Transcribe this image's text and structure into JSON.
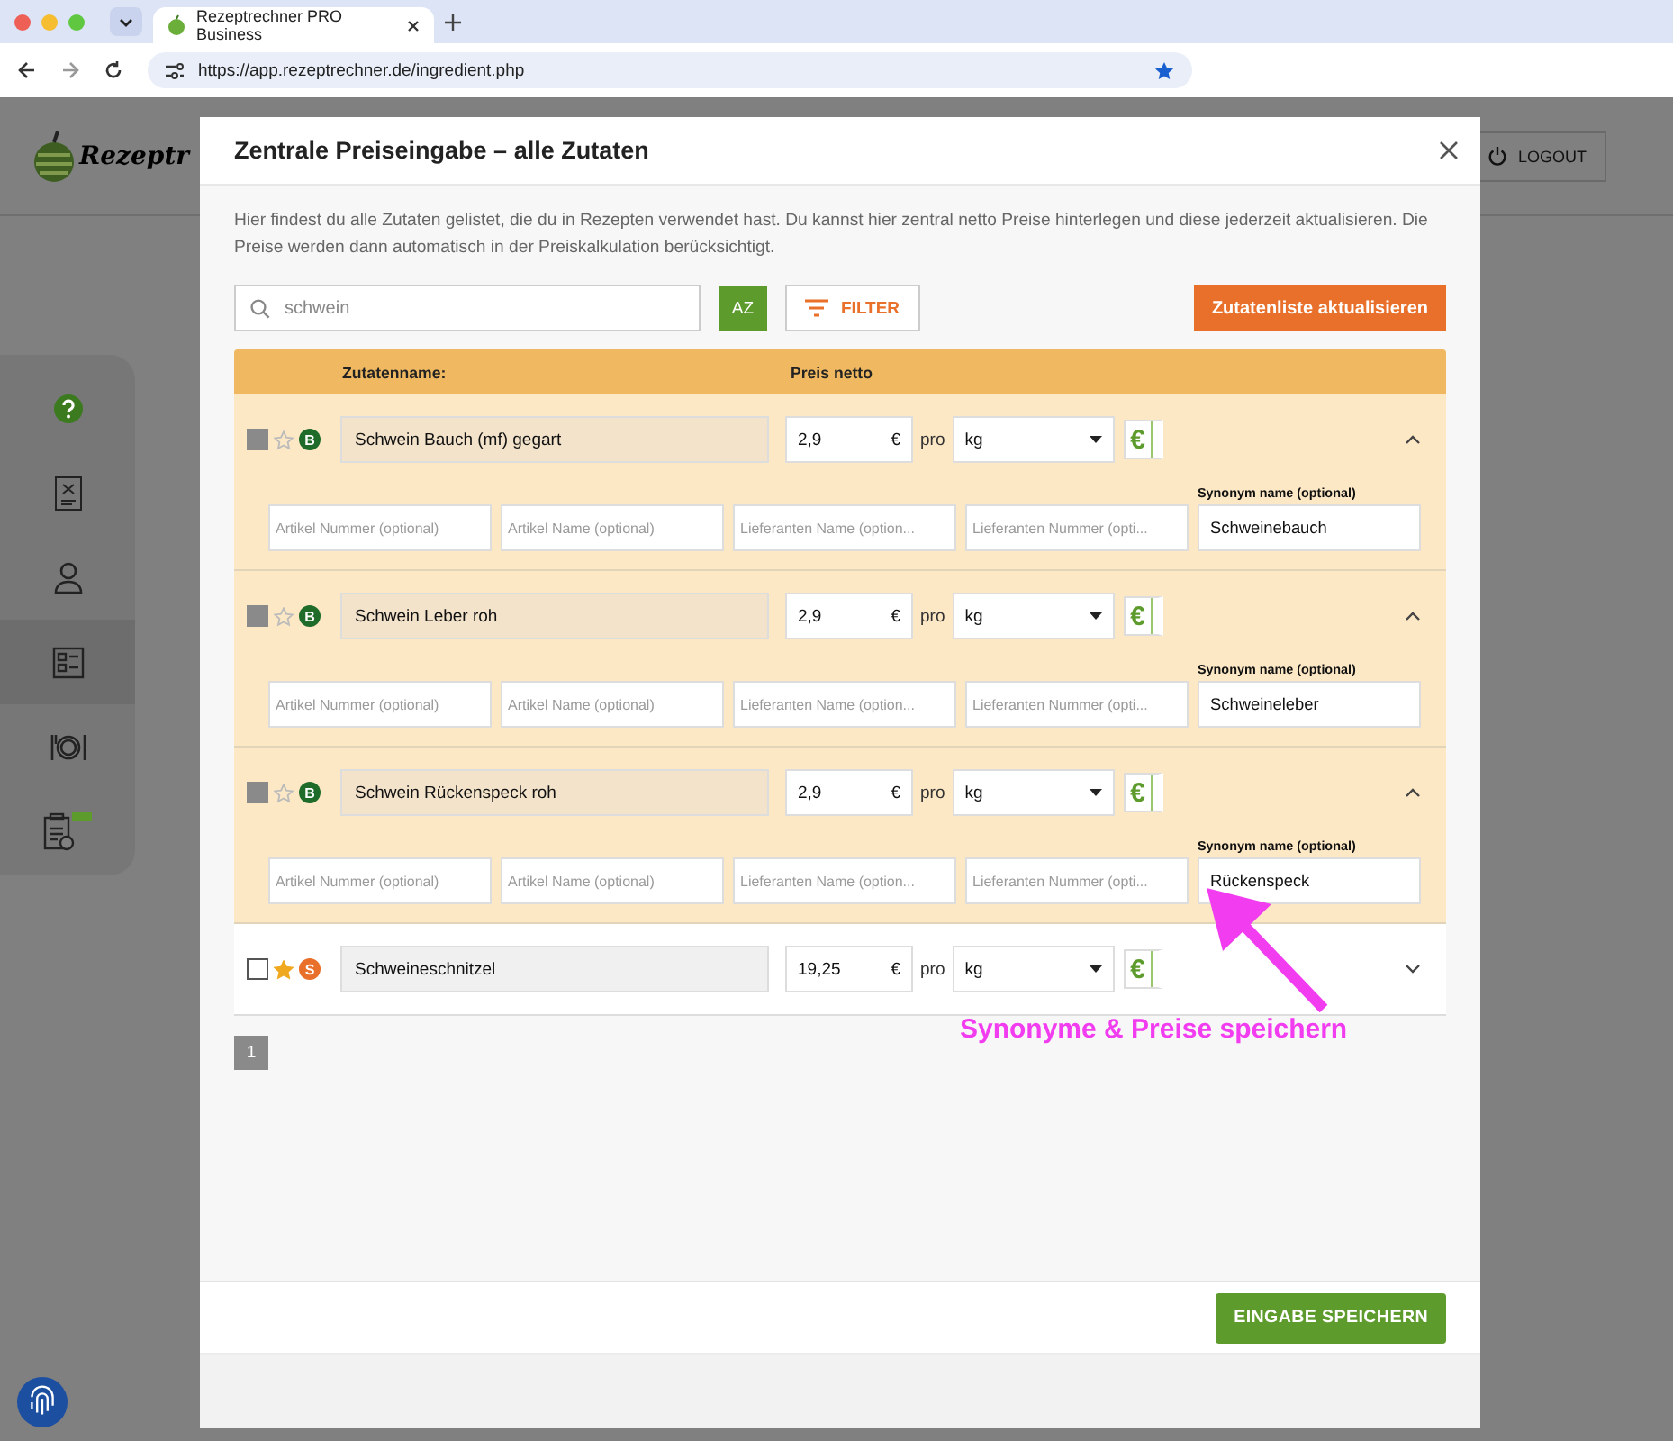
{
  "browser": {
    "tab_title": "Rezeptrechner PRO Business",
    "url": "https://app.rezeptrechner.de/ingredient.php"
  },
  "background": {
    "logo_text": "Rezeptr",
    "logout": "LOGOUT",
    "sidebar": [
      {
        "kind": "help",
        "selected": false
      },
      {
        "kind": "recipe",
        "selected": false
      },
      {
        "kind": "user",
        "selected": false
      },
      {
        "kind": "checklist",
        "selected": true
      },
      {
        "kind": "dish",
        "selected": false
      },
      {
        "kind": "clipboard",
        "selected": false
      }
    ]
  },
  "modal": {
    "title": "Zentrale Preiseingabe – alle Zutaten",
    "description": "Hier findest du alle Zutaten gelistet, die du in Rezepten verwendet hast. Du kannst hier zentral netto Preise hinterlegen und diese jederzeit aktualisieren. Die Preise werden dann automatisch in der Preiskalkulation berücksichtigt.",
    "search": {
      "value": "schwein"
    },
    "sort_button": "AZ",
    "filter_button": "FILTER",
    "refresh_button": "Zutatenliste aktualisieren",
    "columns": [
      "Zutatenname:",
      "Preis netto"
    ],
    "rows": [
      {
        "checked": true,
        "starred": false,
        "badge": "B",
        "color": "#1e6b2a",
        "name": "Schwein Bauch (mf) gegart",
        "price": "2,9",
        "currency": "€",
        "per": "pro",
        "unit": "kg",
        "price_button": "€",
        "expanded": true,
        "details": [
          {
            "placeholder": "Artikel Nummer (optional)"
          },
          {
            "placeholder": "Artikel Name (optional)"
          },
          {
            "placeholder": "Lieferanten Name (option..."
          },
          {
            "placeholder": "Lieferanten Nummer (opti..."
          }
        ],
        "synonym_label": "Synonym name (optional)",
        "synonym": "Schweinebauch"
      },
      {
        "checked": true,
        "starred": false,
        "badge": "B",
        "color": "#1e6b2a",
        "name": "Schwein Leber roh",
        "price": "2,9",
        "currency": "€",
        "per": "pro",
        "unit": "kg",
        "price_button": "€",
        "expanded": true,
        "details": [
          {
            "placeholder": "Artikel Nummer (optional)"
          },
          {
            "placeholder": "Artikel Name (optional)"
          },
          {
            "placeholder": "Lieferanten Name (option..."
          },
          {
            "placeholder": "Lieferanten Nummer (opti..."
          }
        ],
        "synonym_label": "Synonym name (optional)",
        "synonym": "Schweineleber"
      },
      {
        "checked": true,
        "starred": false,
        "badge": "B",
        "color": "#1e6b2a",
        "name": "Schwein Rückenspeck roh",
        "price": "2,9",
        "currency": "€",
        "per": "pro",
        "unit": "kg",
        "price_button": "€",
        "expanded": true,
        "details": [
          {
            "placeholder": "Artikel Nummer (optional)"
          },
          {
            "placeholder": "Artikel Name (optional)"
          },
          {
            "placeholder": "Lieferanten Name (option..."
          },
          {
            "placeholder": "Lieferanten Nummer (opti..."
          }
        ],
        "synonym_label": "Synonym name (optional)",
        "synonym": "Rückenspeck"
      },
      {
        "checked": false,
        "starred": true,
        "badge": "S",
        "color": "#e8702a",
        "name": "Schweineschnitzel",
        "price": "19,25",
        "currency": "€",
        "per": "pro",
        "unit": "kg",
        "price_button": "€",
        "expanded": false
      }
    ],
    "pages": [
      {
        "label": "1",
        "selected": true
      }
    ],
    "save_button": "EINGABE SPEICHERN"
  },
  "annotation": {
    "text": "Synonyme & Preise speichern"
  }
}
